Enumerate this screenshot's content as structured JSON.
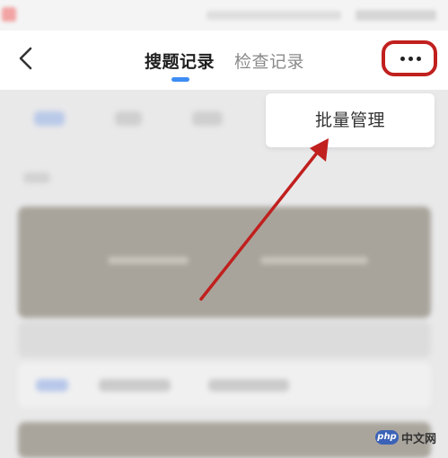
{
  "nav": {
    "back_icon": "chevron-left-icon",
    "tabs": [
      {
        "label": "搜题记录",
        "active": true
      },
      {
        "label": "检查记录",
        "active": false
      }
    ],
    "more_icon": "more-horizontal-icon"
  },
  "popup": {
    "item_label": "批量管理"
  },
  "annotation": {
    "color": "#c0201e"
  },
  "watermark": {
    "logo_text": "php",
    "site_text": "中文网"
  },
  "colors": {
    "tab_indicator": "#3d8df5",
    "annotation_red": "#c0201e"
  }
}
